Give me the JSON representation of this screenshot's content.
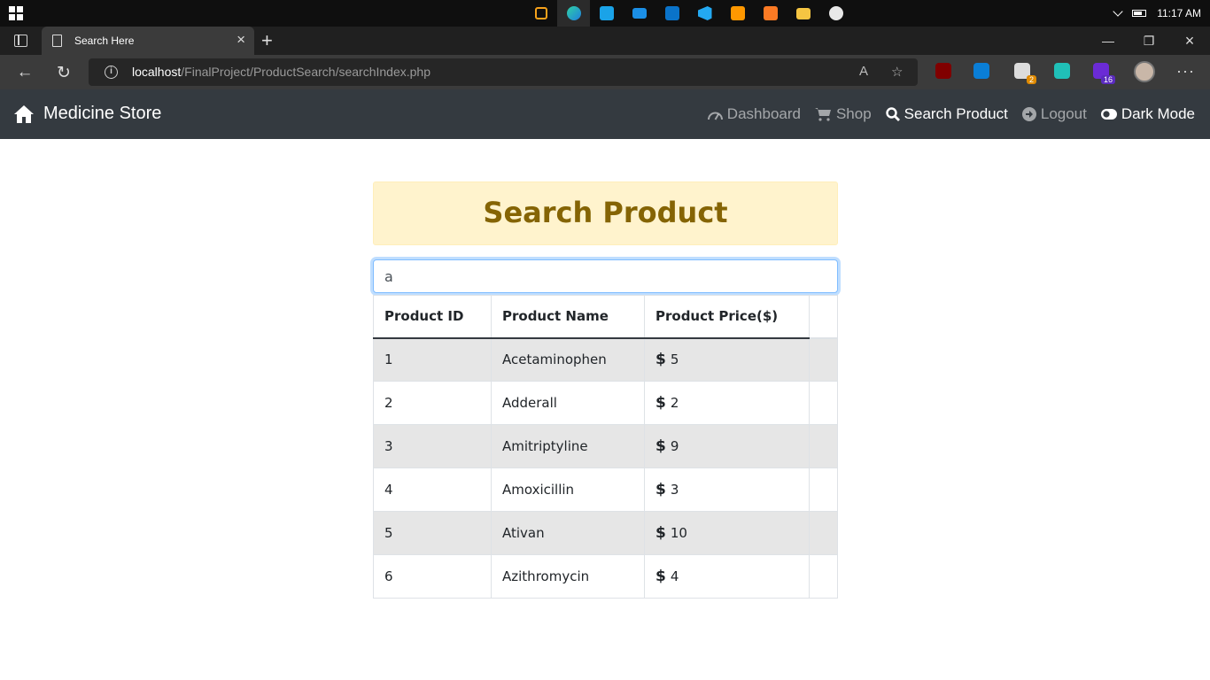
{
  "taskbar": {
    "time": "11:17 AM",
    "apps": [
      "task-view",
      "edge",
      "app-remote",
      "app-screen",
      "app-store",
      "vscode",
      "sublime",
      "xampp",
      "file-explorer",
      "paint"
    ]
  },
  "browser": {
    "tab_title": "Search Here",
    "url_host": "localhost",
    "url_path": "/FinalProject/ProductSearch/searchIndex.php",
    "extension_badges": {
      "ext3": "2",
      "ext5": "16"
    }
  },
  "navbar": {
    "brand": "Medicine Store",
    "links": [
      {
        "label": "Dashboard",
        "icon": "dashboard-icon",
        "active": false
      },
      {
        "label": "Shop",
        "icon": "cart-icon",
        "active": false
      },
      {
        "label": "Search Product",
        "icon": "search-icon",
        "active": true
      },
      {
        "label": "Logout",
        "icon": "logout-icon",
        "active": false
      },
      {
        "label": "Dark Mode",
        "icon": "toggle-icon",
        "active": false
      }
    ]
  },
  "main": {
    "heading": "Search Product",
    "search_value": "a",
    "table": {
      "headers": [
        "Product ID",
        "Product Name",
        "Product Price($)"
      ],
      "rows": [
        {
          "id": "1",
          "name": "Acetaminophen",
          "price": "5"
        },
        {
          "id": "2",
          "name": "Adderall",
          "price": "2"
        },
        {
          "id": "3",
          "name": "Amitriptyline",
          "price": "9"
        },
        {
          "id": "4",
          "name": "Amoxicillin",
          "price": "3"
        },
        {
          "id": "5",
          "name": "Ativan",
          "price": "10"
        },
        {
          "id": "6",
          "name": "Azithromycin",
          "price": "4"
        }
      ]
    }
  },
  "colors": {
    "navbar_bg": "#343a40",
    "heading_bg": "#fff3cd",
    "heading_text": "#856404",
    "stripe": "#e6e6e6"
  }
}
